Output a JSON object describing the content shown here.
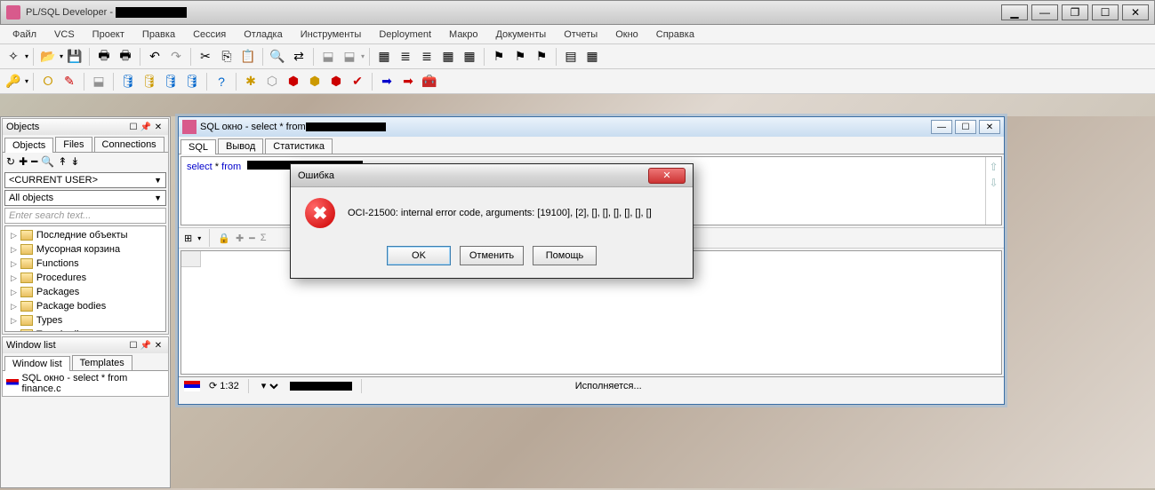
{
  "app": {
    "title": "PL/SQL Developer - "
  },
  "menu": [
    "Файл",
    "VCS",
    "Проект",
    "Правка",
    "Сессия",
    "Отладка",
    "Инструменты",
    "Deployment",
    "Макро",
    "Документы",
    "Отчеты",
    "Окно",
    "Справка"
  ],
  "sidebar": {
    "objects_panel": "Objects",
    "tabs": [
      "Objects",
      "Files",
      "Connections"
    ],
    "combo_user": "<CURRENT USER>",
    "combo_filter": "All objects",
    "search_placeholder": "Enter search text...",
    "tree": [
      "Последние объекты",
      "Мусорная корзина",
      "Functions",
      "Procedures",
      "Packages",
      "Package bodies",
      "Types",
      "Type bodies"
    ],
    "windowlist_panel": "Window list",
    "wl_tabs": [
      "Window list",
      "Templates"
    ],
    "wl_item": "SQL окно - select * from finance.c"
  },
  "child": {
    "title": "SQL окно - select * from ",
    "tabs": [
      "SQL",
      "Вывод",
      "Статистика"
    ],
    "sql_kw1": "select",
    "sql_kw2": "from",
    "sql_star": " * ",
    "status_time": "1:32",
    "status_exec": "Исполняется..."
  },
  "dialog": {
    "title": "Ошибка",
    "message": "OCI-21500: internal error code, arguments: [19100], [2], [], [], [], [], [], []",
    "ok": "OK",
    "cancel": "Отменить",
    "help": "Помощь"
  }
}
